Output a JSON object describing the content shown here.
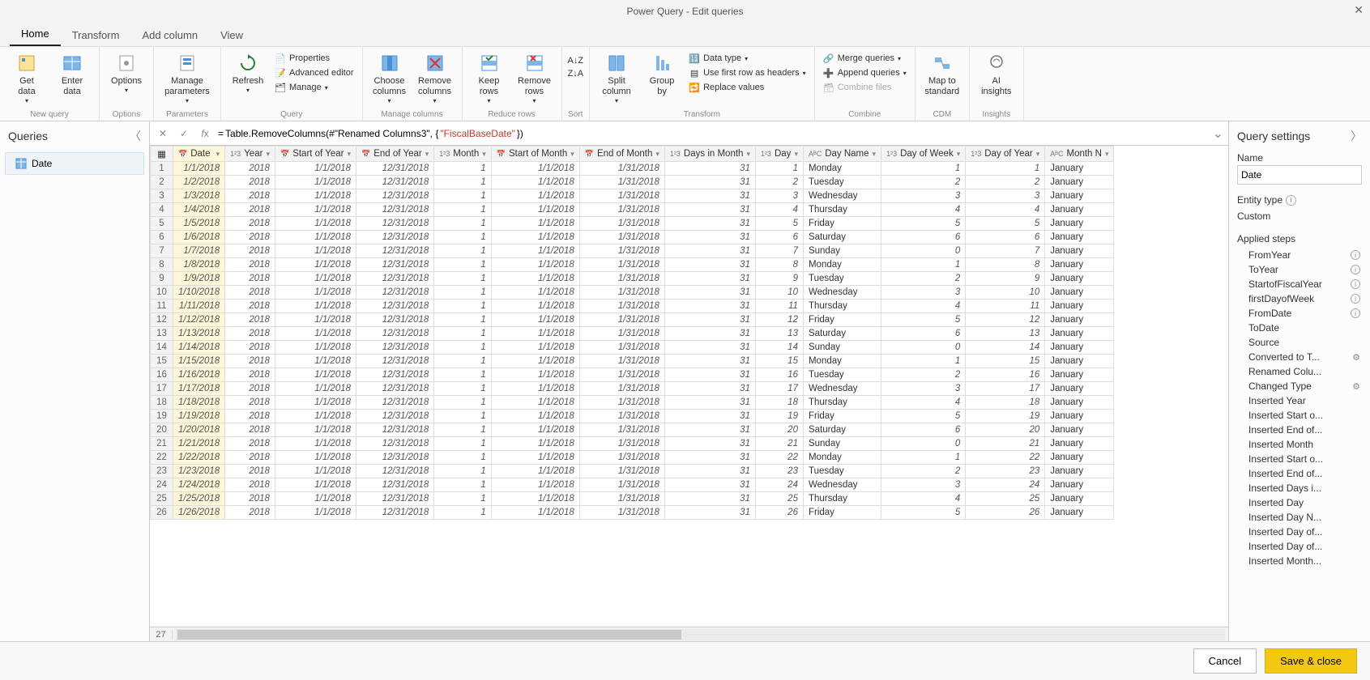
{
  "window": {
    "title": "Power Query - Edit queries"
  },
  "ribbon_tabs": [
    "Home",
    "Transform",
    "Add column",
    "View"
  ],
  "ribbon": {
    "new_query": {
      "get_data": "Get\ndata",
      "enter_data": "Enter\ndata",
      "label": "New query"
    },
    "options": {
      "options": "Options",
      "label": "Options"
    },
    "parameters": {
      "manage": "Manage\nparameters",
      "label": "Parameters"
    },
    "query": {
      "refresh": "Refresh",
      "properties": "Properties",
      "advanced": "Advanced editor",
      "manage": "Manage",
      "label": "Query"
    },
    "manage_columns": {
      "choose": "Choose\ncolumns",
      "remove": "Remove\ncolumns",
      "label": "Manage columns"
    },
    "reduce_rows": {
      "keep": "Keep\nrows",
      "remove": "Remove\nrows",
      "label": "Reduce rows"
    },
    "sort": {
      "label": "Sort"
    },
    "transform": {
      "split": "Split\ncolumn",
      "group": "Group\nby",
      "datatype": "Data type",
      "firstrow": "Use first row as headers",
      "replace": "Replace values",
      "label": "Transform"
    },
    "combine": {
      "merge": "Merge queries",
      "append": "Append queries",
      "combine_files": "Combine files",
      "label": "Combine"
    },
    "cdm": {
      "map": "Map to\nstandard",
      "label": "CDM"
    },
    "insights": {
      "ai": "AI\ninsights",
      "label": "Insights"
    }
  },
  "queries": {
    "title": "Queries",
    "items": [
      "Date"
    ]
  },
  "formula": {
    "prefix": "= ",
    "text1": "Table.RemoveColumns(#\"Renamed Columns3\", {",
    "literal": "\"FiscalBaseDate\"",
    "text2": "})"
  },
  "columns": [
    {
      "name": "Date",
      "type": "date",
      "sel": true
    },
    {
      "name": "Year",
      "type": "num"
    },
    {
      "name": "Start of Year",
      "type": "date"
    },
    {
      "name": "End of Year",
      "type": "date"
    },
    {
      "name": "Month",
      "type": "num"
    },
    {
      "name": "Start of Month",
      "type": "date"
    },
    {
      "name": "End of Month",
      "type": "date"
    },
    {
      "name": "Days in Month",
      "type": "num"
    },
    {
      "name": "Day",
      "type": "num"
    },
    {
      "name": "Day Name",
      "type": "text"
    },
    {
      "name": "Day of Week",
      "type": "num"
    },
    {
      "name": "Day of Year",
      "type": "num"
    },
    {
      "name": "Month N",
      "type": "text"
    }
  ],
  "rows": [
    [
      "1/1/2018",
      "2018",
      "1/1/2018",
      "12/31/2018",
      "1",
      "1/1/2018",
      "1/31/2018",
      "31",
      "1",
      "Monday",
      "1",
      "1",
      "January"
    ],
    [
      "1/2/2018",
      "2018",
      "1/1/2018",
      "12/31/2018",
      "1",
      "1/1/2018",
      "1/31/2018",
      "31",
      "2",
      "Tuesday",
      "2",
      "2",
      "January"
    ],
    [
      "1/3/2018",
      "2018",
      "1/1/2018",
      "12/31/2018",
      "1",
      "1/1/2018",
      "1/31/2018",
      "31",
      "3",
      "Wednesday",
      "3",
      "3",
      "January"
    ],
    [
      "1/4/2018",
      "2018",
      "1/1/2018",
      "12/31/2018",
      "1",
      "1/1/2018",
      "1/31/2018",
      "31",
      "4",
      "Thursday",
      "4",
      "4",
      "January"
    ],
    [
      "1/5/2018",
      "2018",
      "1/1/2018",
      "12/31/2018",
      "1",
      "1/1/2018",
      "1/31/2018",
      "31",
      "5",
      "Friday",
      "5",
      "5",
      "January"
    ],
    [
      "1/6/2018",
      "2018",
      "1/1/2018",
      "12/31/2018",
      "1",
      "1/1/2018",
      "1/31/2018",
      "31",
      "6",
      "Saturday",
      "6",
      "6",
      "January"
    ],
    [
      "1/7/2018",
      "2018",
      "1/1/2018",
      "12/31/2018",
      "1",
      "1/1/2018",
      "1/31/2018",
      "31",
      "7",
      "Sunday",
      "0",
      "7",
      "January"
    ],
    [
      "1/8/2018",
      "2018",
      "1/1/2018",
      "12/31/2018",
      "1",
      "1/1/2018",
      "1/31/2018",
      "31",
      "8",
      "Monday",
      "1",
      "8",
      "January"
    ],
    [
      "1/9/2018",
      "2018",
      "1/1/2018",
      "12/31/2018",
      "1",
      "1/1/2018",
      "1/31/2018",
      "31",
      "9",
      "Tuesday",
      "2",
      "9",
      "January"
    ],
    [
      "1/10/2018",
      "2018",
      "1/1/2018",
      "12/31/2018",
      "1",
      "1/1/2018",
      "1/31/2018",
      "31",
      "10",
      "Wednesday",
      "3",
      "10",
      "January"
    ],
    [
      "1/11/2018",
      "2018",
      "1/1/2018",
      "12/31/2018",
      "1",
      "1/1/2018",
      "1/31/2018",
      "31",
      "11",
      "Thursday",
      "4",
      "11",
      "January"
    ],
    [
      "1/12/2018",
      "2018",
      "1/1/2018",
      "12/31/2018",
      "1",
      "1/1/2018",
      "1/31/2018",
      "31",
      "12",
      "Friday",
      "5",
      "12",
      "January"
    ],
    [
      "1/13/2018",
      "2018",
      "1/1/2018",
      "12/31/2018",
      "1",
      "1/1/2018",
      "1/31/2018",
      "31",
      "13",
      "Saturday",
      "6",
      "13",
      "January"
    ],
    [
      "1/14/2018",
      "2018",
      "1/1/2018",
      "12/31/2018",
      "1",
      "1/1/2018",
      "1/31/2018",
      "31",
      "14",
      "Sunday",
      "0",
      "14",
      "January"
    ],
    [
      "1/15/2018",
      "2018",
      "1/1/2018",
      "12/31/2018",
      "1",
      "1/1/2018",
      "1/31/2018",
      "31",
      "15",
      "Monday",
      "1",
      "15",
      "January"
    ],
    [
      "1/16/2018",
      "2018",
      "1/1/2018",
      "12/31/2018",
      "1",
      "1/1/2018",
      "1/31/2018",
      "31",
      "16",
      "Tuesday",
      "2",
      "16",
      "January"
    ],
    [
      "1/17/2018",
      "2018",
      "1/1/2018",
      "12/31/2018",
      "1",
      "1/1/2018",
      "1/31/2018",
      "31",
      "17",
      "Wednesday",
      "3",
      "17",
      "January"
    ],
    [
      "1/18/2018",
      "2018",
      "1/1/2018",
      "12/31/2018",
      "1",
      "1/1/2018",
      "1/31/2018",
      "31",
      "18",
      "Thursday",
      "4",
      "18",
      "January"
    ],
    [
      "1/19/2018",
      "2018",
      "1/1/2018",
      "12/31/2018",
      "1",
      "1/1/2018",
      "1/31/2018",
      "31",
      "19",
      "Friday",
      "5",
      "19",
      "January"
    ],
    [
      "1/20/2018",
      "2018",
      "1/1/2018",
      "12/31/2018",
      "1",
      "1/1/2018",
      "1/31/2018",
      "31",
      "20",
      "Saturday",
      "6",
      "20",
      "January"
    ],
    [
      "1/21/2018",
      "2018",
      "1/1/2018",
      "12/31/2018",
      "1",
      "1/1/2018",
      "1/31/2018",
      "31",
      "21",
      "Sunday",
      "0",
      "21",
      "January"
    ],
    [
      "1/22/2018",
      "2018",
      "1/1/2018",
      "12/31/2018",
      "1",
      "1/1/2018",
      "1/31/2018",
      "31",
      "22",
      "Monday",
      "1",
      "22",
      "January"
    ],
    [
      "1/23/2018",
      "2018",
      "1/1/2018",
      "12/31/2018",
      "1",
      "1/1/2018",
      "1/31/2018",
      "31",
      "23",
      "Tuesday",
      "2",
      "23",
      "January"
    ],
    [
      "1/24/2018",
      "2018",
      "1/1/2018",
      "12/31/2018",
      "1",
      "1/1/2018",
      "1/31/2018",
      "31",
      "24",
      "Wednesday",
      "3",
      "24",
      "January"
    ],
    [
      "1/25/2018",
      "2018",
      "1/1/2018",
      "12/31/2018",
      "1",
      "1/1/2018",
      "1/31/2018",
      "31",
      "25",
      "Thursday",
      "4",
      "25",
      "January"
    ],
    [
      "1/26/2018",
      "2018",
      "1/1/2018",
      "12/31/2018",
      "1",
      "1/1/2018",
      "1/31/2018",
      "31",
      "26",
      "Friday",
      "5",
      "26",
      "January"
    ]
  ],
  "extra_rownum": "27",
  "settings": {
    "title": "Query settings",
    "name_label": "Name",
    "name_value": "Date",
    "entity_label": "Entity type",
    "entity_value": "Custom",
    "steps_label": "Applied steps",
    "steps": [
      {
        "label": "FromYear",
        "info": true
      },
      {
        "label": "ToYear",
        "info": true
      },
      {
        "label": "StartofFiscalYear",
        "info": true
      },
      {
        "label": "firstDayofWeek",
        "info": true
      },
      {
        "label": "FromDate",
        "info": true
      },
      {
        "label": "ToDate"
      },
      {
        "label": "Source"
      },
      {
        "label": "Converted to T...",
        "gear": true
      },
      {
        "label": "Renamed Colu..."
      },
      {
        "label": "Changed Type",
        "gear": true
      },
      {
        "label": "Inserted Year"
      },
      {
        "label": "Inserted Start o..."
      },
      {
        "label": "Inserted End of..."
      },
      {
        "label": "Inserted Month"
      },
      {
        "label": "Inserted Start o..."
      },
      {
        "label": "Inserted End of..."
      },
      {
        "label": "Inserted Days i..."
      },
      {
        "label": "Inserted Day"
      },
      {
        "label": "Inserted Day N..."
      },
      {
        "label": "Inserted Day of..."
      },
      {
        "label": "Inserted Day of..."
      },
      {
        "label": "Inserted Month..."
      }
    ]
  },
  "footer": {
    "cancel": "Cancel",
    "save": "Save & close"
  }
}
